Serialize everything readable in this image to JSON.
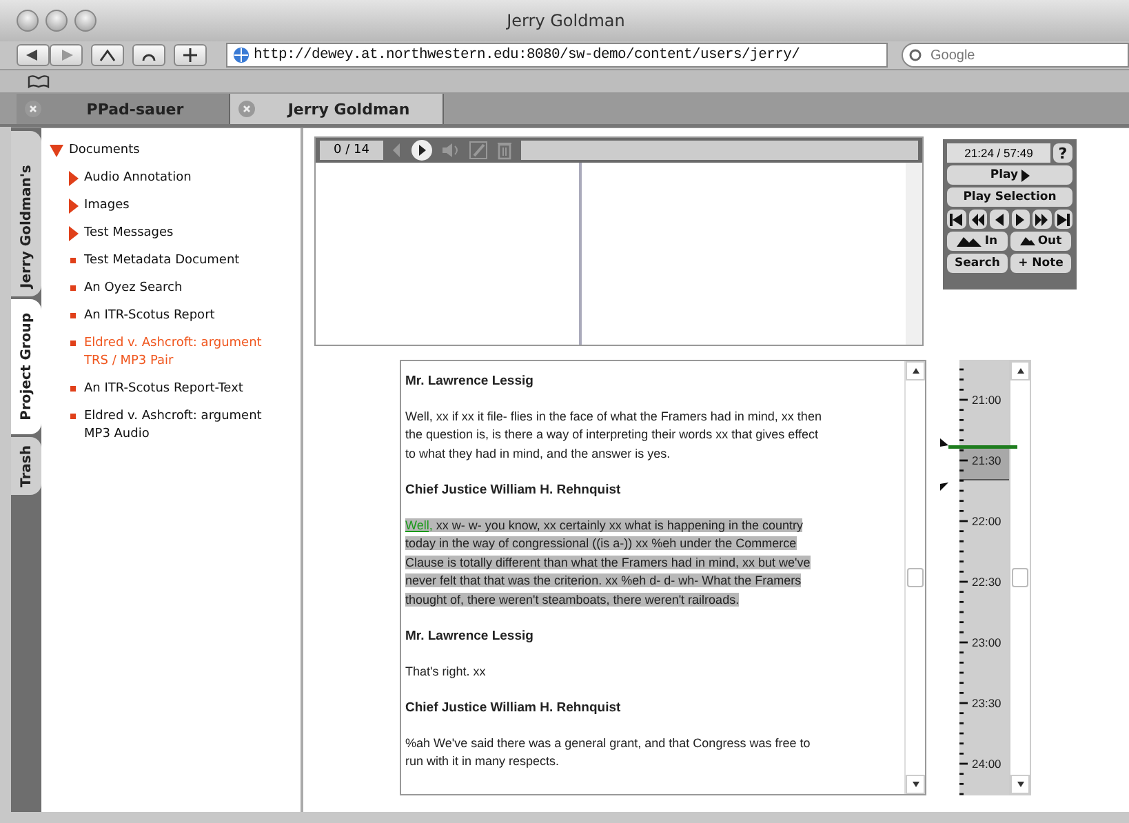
{
  "window": {
    "title": "Jerry Goldman"
  },
  "toolbar": {
    "url": "http://dewey.at.northwestern.edu:8080/sw-demo/content/users/jerry/",
    "search_placeholder": "Google"
  },
  "browser_tabs": [
    {
      "label": "PPad-sauer",
      "selected": false
    },
    {
      "label": "Jerry Goldman",
      "selected": true
    }
  ],
  "side_tabs": [
    {
      "label": "Jerry Goldman's",
      "selected": false
    },
    {
      "label": "Project Group",
      "selected": true
    },
    {
      "label": "Trash",
      "selected": false
    }
  ],
  "tree": {
    "label": "Documents",
    "expanded": true,
    "children": [
      {
        "label": "Audio Annotation",
        "kind": "folder",
        "selected": false
      },
      {
        "label": "Images",
        "kind": "folder",
        "selected": false
      },
      {
        "label": "Test Messages",
        "kind": "folder",
        "selected": false
      },
      {
        "label": "Test Metadata Document",
        "kind": "document",
        "selected": false
      },
      {
        "label": "An Oyez Search",
        "kind": "document",
        "selected": false
      },
      {
        "label": "An ITR-Scotus Report",
        "kind": "document",
        "selected": false
      },
      {
        "label": "Eldred v. Ashcroft: argument TRS / MP3 Pair",
        "kind": "document",
        "selected": true
      },
      {
        "label": "An ITR-Scotus Report-Text",
        "kind": "document",
        "selected": false
      },
      {
        "label": "Eldred v. Ashcroft: argument MP3 Audio",
        "kind": "document",
        "selected": false
      }
    ]
  },
  "player": {
    "counter": "0 / 14"
  },
  "controls": {
    "time": "21:24 / 57:49",
    "help": "?",
    "play": "Play",
    "play_selection": "Play Selection",
    "zoom_in": "In",
    "zoom_out": "Out",
    "search": "Search",
    "note": "+ Note"
  },
  "transcript": [
    {
      "kind": "speaker",
      "text": "Mr. Lawrence Lessig"
    },
    {
      "kind": "speech",
      "text": "Well, xx if xx it file- flies in the face of what the Framers had in mind, xx then the question is, is there a way of interpreting their words xx that gives effect to what they had in mind, and the answer is yes.",
      "highlighted": false
    },
    {
      "kind": "speaker",
      "text": "Chief Justice William H. Rehnquist"
    },
    {
      "kind": "speech",
      "link": "Well,",
      "text": "xx w- w- you know, xx certainly xx what is happening in the country today in the way of congressional ((is a-)) xx %eh under the Commerce Clause is totally different than what the Framers had in mind, xx but we've never felt that that was the criterion. xx %eh d- d- wh- What the Framers thought of, there weren't steamboats, there weren't railroads.",
      "highlighted": true
    },
    {
      "kind": "speaker",
      "text": "Mr. Lawrence Lessig"
    },
    {
      "kind": "speech",
      "text": "That's right. xx",
      "highlighted": false
    },
    {
      "kind": "speaker",
      "text": "Chief Justice William H. Rehnquist"
    },
    {
      "kind": "speech",
      "text": "%ah We've said there was a general grant, and that Congress was free to run with it in many respects.",
      "highlighted": false
    }
  ],
  "timeline": {
    "labels": [
      "21:00",
      "21:30",
      "22:00",
      "22:30",
      "23:00",
      "23:30",
      "24:00"
    ]
  }
}
